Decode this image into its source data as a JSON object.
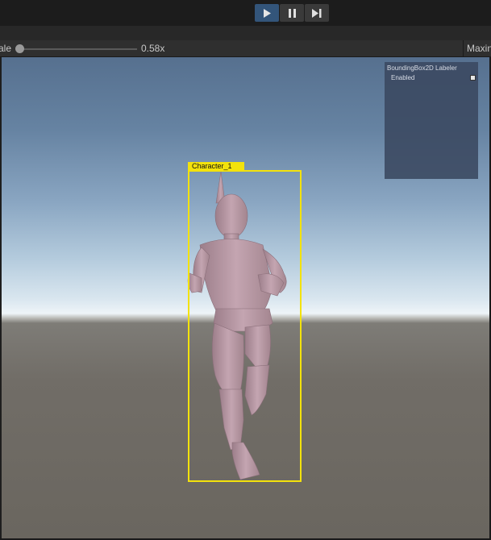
{
  "toolbar": {
    "play_icon": "play-icon",
    "pause_icon": "pause-icon",
    "step_icon": "step-forward-icon",
    "active_color": "#33557a"
  },
  "game_view": {
    "scale_label": "ale",
    "scale_value": "0.58x",
    "maximize_label": "Maxin"
  },
  "overlay_panel": {
    "title": "BoundingBox2D Labeler",
    "enabled_label": "Enabled"
  },
  "bounding_box": {
    "label": "Character_1",
    "color": "#f3e20c"
  }
}
